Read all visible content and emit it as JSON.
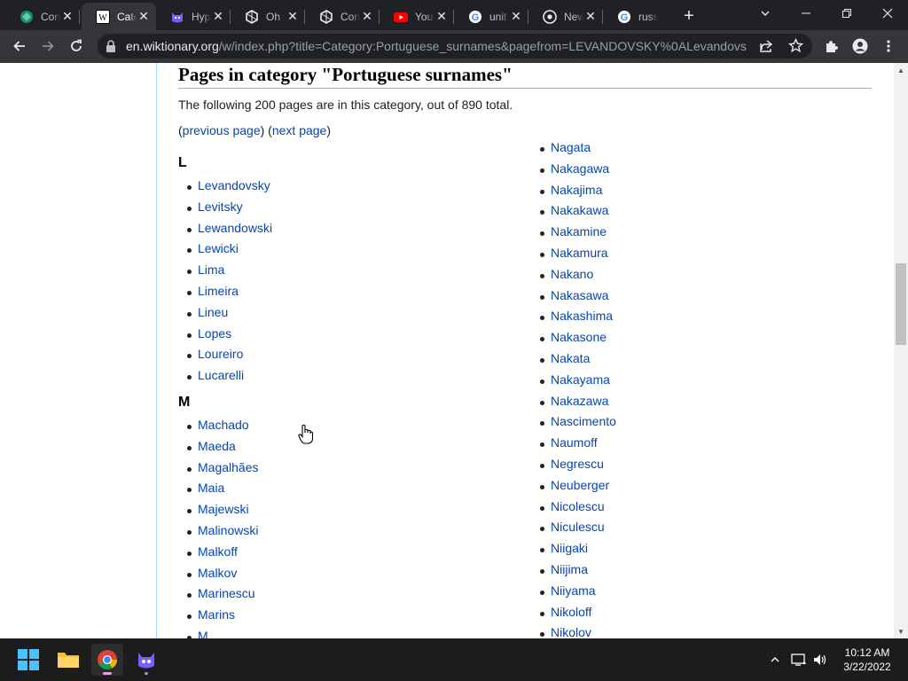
{
  "tabs": [
    {
      "title": "Con",
      "icon": "green-sphere-icon"
    },
    {
      "title": "Cate",
      "icon": "wiktionary-icon"
    },
    {
      "title": "Hyp",
      "icon": "purple-cat-icon"
    },
    {
      "title": "Oh",
      "icon": "polygon-icon"
    },
    {
      "title": "Con",
      "icon": "polygon-icon"
    },
    {
      "title": "You",
      "icon": "youtube-icon"
    },
    {
      "title": "unit",
      "icon": "google-icon"
    },
    {
      "title": "New",
      "icon": "chrome-icon"
    },
    {
      "title": "russia va",
      "icon": "google-icon"
    }
  ],
  "address": {
    "host": "en.wiktionary.org",
    "path": "/w/index.php?title=Category:Portuguese_surnames&pagefrom=LEVANDOVSKY%0ALevandovs..."
  },
  "page": {
    "heading": "Pages in category \"Portuguese surnames\"",
    "summary": "The following 200 pages are in this category, out of 890 total.",
    "prev": "previous page",
    "next": "next page",
    "paren_open": "(",
    "paren_mid": ") (",
    "paren_close": ")"
  },
  "groups": [
    {
      "letter": "L",
      "items": [
        "Levandovsky",
        "Levitsky",
        "Lewandowski",
        "Lewicki",
        "Lima",
        "Limeira",
        "Lineu",
        "Lopes",
        "Loureiro",
        "Lucarelli"
      ]
    },
    {
      "letter": "M",
      "items": [
        "Machado",
        "Maeda",
        "Magalhães",
        "Maia",
        "Majewski",
        "Malinowski",
        "Malkoff",
        "Malkov",
        "Marinescu",
        "Marins",
        "M"
      ]
    }
  ],
  "right_column": [
    "Nagata",
    "Nakagawa",
    "Nakajima",
    "Nakakawa",
    "Nakamine",
    "Nakamura",
    "Nakano",
    "Nakasawa",
    "Nakashima",
    "Nakasone",
    "Nakata",
    "Nakayama",
    "Nakazawa",
    "Nascimento",
    "Naumoff",
    "Negrescu",
    "Neuberger",
    "Nicolescu",
    "Niculescu",
    "Niigaki",
    "Niijima",
    "Niiyama",
    "Nikoloff",
    "Nikolov"
  ],
  "clock": {
    "time": "10:12 AM",
    "date": "3/22/2022"
  },
  "colors": {
    "link": "#0645ad",
    "tab_bar": "#202124",
    "toolbar": "#35363a",
    "taskbar": "#1c1c1c"
  }
}
